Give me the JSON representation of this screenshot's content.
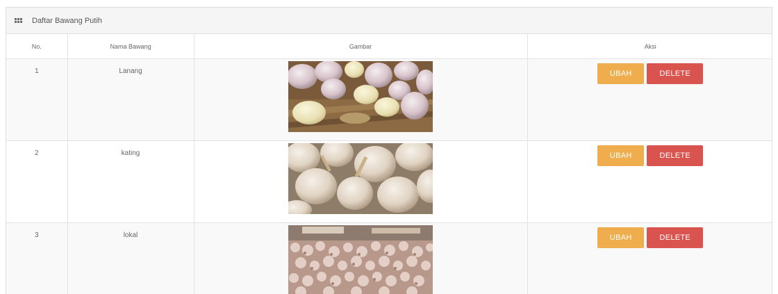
{
  "panel": {
    "title": "Daftar Bawang Putih",
    "icon": "grid-icon"
  },
  "table": {
    "headers": [
      "No.",
      "Nama Bawang",
      "Gambar",
      "Aksi"
    ],
    "rows": [
      {
        "no": "1",
        "name": "Lanang",
        "image": "garlic-cloves-photo"
      },
      {
        "no": "2",
        "name": "kating",
        "image": "garlic-bulbs-photo"
      },
      {
        "no": "3",
        "name": "lokal",
        "image": "garlic-market-photo"
      }
    ],
    "edit_label": "UBAH",
    "delete_label": "DELETE"
  },
  "colors": {
    "edit_button": "#f0ad4e",
    "delete_button": "#d9534f",
    "header_bg": "#f5f5f5",
    "stripe": "#f9f9f9"
  }
}
